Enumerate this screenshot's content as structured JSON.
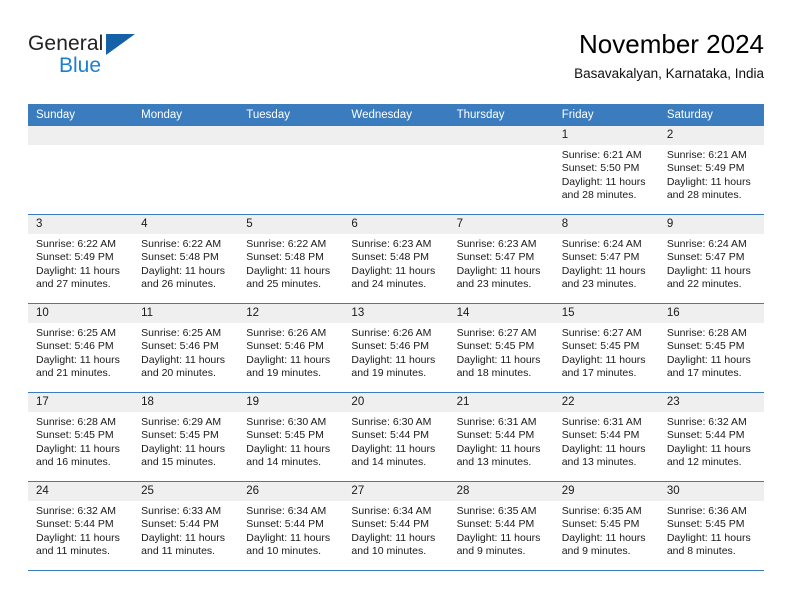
{
  "brand": {
    "name_top": "General",
    "name_bottom": "Blue",
    "logo_icon": "triangle-logo-icon",
    "color_blue": "#1b7fd4",
    "color_dark_blue": "#1461a8"
  },
  "header": {
    "title": "November 2024",
    "subtitle": "Basavakalyan, Karnataka, India"
  },
  "theme": {
    "header_row_bg": "#3a7cbe",
    "daynum_bg": "#efefef",
    "cell_bg": "#ffffff",
    "divider": "#3a7cbe"
  },
  "columns": [
    "Sunday",
    "Monday",
    "Tuesday",
    "Wednesday",
    "Thursday",
    "Friday",
    "Saturday"
  ],
  "weeks": [
    [
      {
        "day": "",
        "empty": true
      },
      {
        "day": "",
        "empty": true
      },
      {
        "day": "",
        "empty": true
      },
      {
        "day": "",
        "empty": true
      },
      {
        "day": "",
        "empty": true
      },
      {
        "day": "1",
        "sunrise": "Sunrise: 6:21 AM",
        "sunset": "Sunset: 5:50 PM",
        "daylight": "Daylight: 11 hours and 28 minutes."
      },
      {
        "day": "2",
        "sunrise": "Sunrise: 6:21 AM",
        "sunset": "Sunset: 5:49 PM",
        "daylight": "Daylight: 11 hours and 28 minutes."
      }
    ],
    [
      {
        "day": "3",
        "sunrise": "Sunrise: 6:22 AM",
        "sunset": "Sunset: 5:49 PM",
        "daylight": "Daylight: 11 hours and 27 minutes."
      },
      {
        "day": "4",
        "sunrise": "Sunrise: 6:22 AM",
        "sunset": "Sunset: 5:48 PM",
        "daylight": "Daylight: 11 hours and 26 minutes."
      },
      {
        "day": "5",
        "sunrise": "Sunrise: 6:22 AM",
        "sunset": "Sunset: 5:48 PM",
        "daylight": "Daylight: 11 hours and 25 minutes."
      },
      {
        "day": "6",
        "sunrise": "Sunrise: 6:23 AM",
        "sunset": "Sunset: 5:48 PM",
        "daylight": "Daylight: 11 hours and 24 minutes."
      },
      {
        "day": "7",
        "sunrise": "Sunrise: 6:23 AM",
        "sunset": "Sunset: 5:47 PM",
        "daylight": "Daylight: 11 hours and 23 minutes."
      },
      {
        "day": "8",
        "sunrise": "Sunrise: 6:24 AM",
        "sunset": "Sunset: 5:47 PM",
        "daylight": "Daylight: 11 hours and 23 minutes."
      },
      {
        "day": "9",
        "sunrise": "Sunrise: 6:24 AM",
        "sunset": "Sunset: 5:47 PM",
        "daylight": "Daylight: 11 hours and 22 minutes."
      }
    ],
    [
      {
        "day": "10",
        "sunrise": "Sunrise: 6:25 AM",
        "sunset": "Sunset: 5:46 PM",
        "daylight": "Daylight: 11 hours and 21 minutes."
      },
      {
        "day": "11",
        "sunrise": "Sunrise: 6:25 AM",
        "sunset": "Sunset: 5:46 PM",
        "daylight": "Daylight: 11 hours and 20 minutes."
      },
      {
        "day": "12",
        "sunrise": "Sunrise: 6:26 AM",
        "sunset": "Sunset: 5:46 PM",
        "daylight": "Daylight: 11 hours and 19 minutes."
      },
      {
        "day": "13",
        "sunrise": "Sunrise: 6:26 AM",
        "sunset": "Sunset: 5:46 PM",
        "daylight": "Daylight: 11 hours and 19 minutes."
      },
      {
        "day": "14",
        "sunrise": "Sunrise: 6:27 AM",
        "sunset": "Sunset: 5:45 PM",
        "daylight": "Daylight: 11 hours and 18 minutes."
      },
      {
        "day": "15",
        "sunrise": "Sunrise: 6:27 AM",
        "sunset": "Sunset: 5:45 PM",
        "daylight": "Daylight: 11 hours and 17 minutes."
      },
      {
        "day": "16",
        "sunrise": "Sunrise: 6:28 AM",
        "sunset": "Sunset: 5:45 PM",
        "daylight": "Daylight: 11 hours and 17 minutes."
      }
    ],
    [
      {
        "day": "17",
        "sunrise": "Sunrise: 6:28 AM",
        "sunset": "Sunset: 5:45 PM",
        "daylight": "Daylight: 11 hours and 16 minutes."
      },
      {
        "day": "18",
        "sunrise": "Sunrise: 6:29 AM",
        "sunset": "Sunset: 5:45 PM",
        "daylight": "Daylight: 11 hours and 15 minutes."
      },
      {
        "day": "19",
        "sunrise": "Sunrise: 6:30 AM",
        "sunset": "Sunset: 5:45 PM",
        "daylight": "Daylight: 11 hours and 14 minutes."
      },
      {
        "day": "20",
        "sunrise": "Sunrise: 6:30 AM",
        "sunset": "Sunset: 5:44 PM",
        "daylight": "Daylight: 11 hours and 14 minutes."
      },
      {
        "day": "21",
        "sunrise": "Sunrise: 6:31 AM",
        "sunset": "Sunset: 5:44 PM",
        "daylight": "Daylight: 11 hours and 13 minutes."
      },
      {
        "day": "22",
        "sunrise": "Sunrise: 6:31 AM",
        "sunset": "Sunset: 5:44 PM",
        "daylight": "Daylight: 11 hours and 13 minutes."
      },
      {
        "day": "23",
        "sunrise": "Sunrise: 6:32 AM",
        "sunset": "Sunset: 5:44 PM",
        "daylight": "Daylight: 11 hours and 12 minutes."
      }
    ],
    [
      {
        "day": "24",
        "sunrise": "Sunrise: 6:32 AM",
        "sunset": "Sunset: 5:44 PM",
        "daylight": "Daylight: 11 hours and 11 minutes."
      },
      {
        "day": "25",
        "sunrise": "Sunrise: 6:33 AM",
        "sunset": "Sunset: 5:44 PM",
        "daylight": "Daylight: 11 hours and 11 minutes."
      },
      {
        "day": "26",
        "sunrise": "Sunrise: 6:34 AM",
        "sunset": "Sunset: 5:44 PM",
        "daylight": "Daylight: 11 hours and 10 minutes."
      },
      {
        "day": "27",
        "sunrise": "Sunrise: 6:34 AM",
        "sunset": "Sunset: 5:44 PM",
        "daylight": "Daylight: 11 hours and 10 minutes."
      },
      {
        "day": "28",
        "sunrise": "Sunrise: 6:35 AM",
        "sunset": "Sunset: 5:44 PM",
        "daylight": "Daylight: 11 hours and 9 minutes."
      },
      {
        "day": "29",
        "sunrise": "Sunrise: 6:35 AM",
        "sunset": "Sunset: 5:45 PM",
        "daylight": "Daylight: 11 hours and 9 minutes."
      },
      {
        "day": "30",
        "sunrise": "Sunrise: 6:36 AM",
        "sunset": "Sunset: 5:45 PM",
        "daylight": "Daylight: 11 hours and 8 minutes."
      }
    ]
  ]
}
